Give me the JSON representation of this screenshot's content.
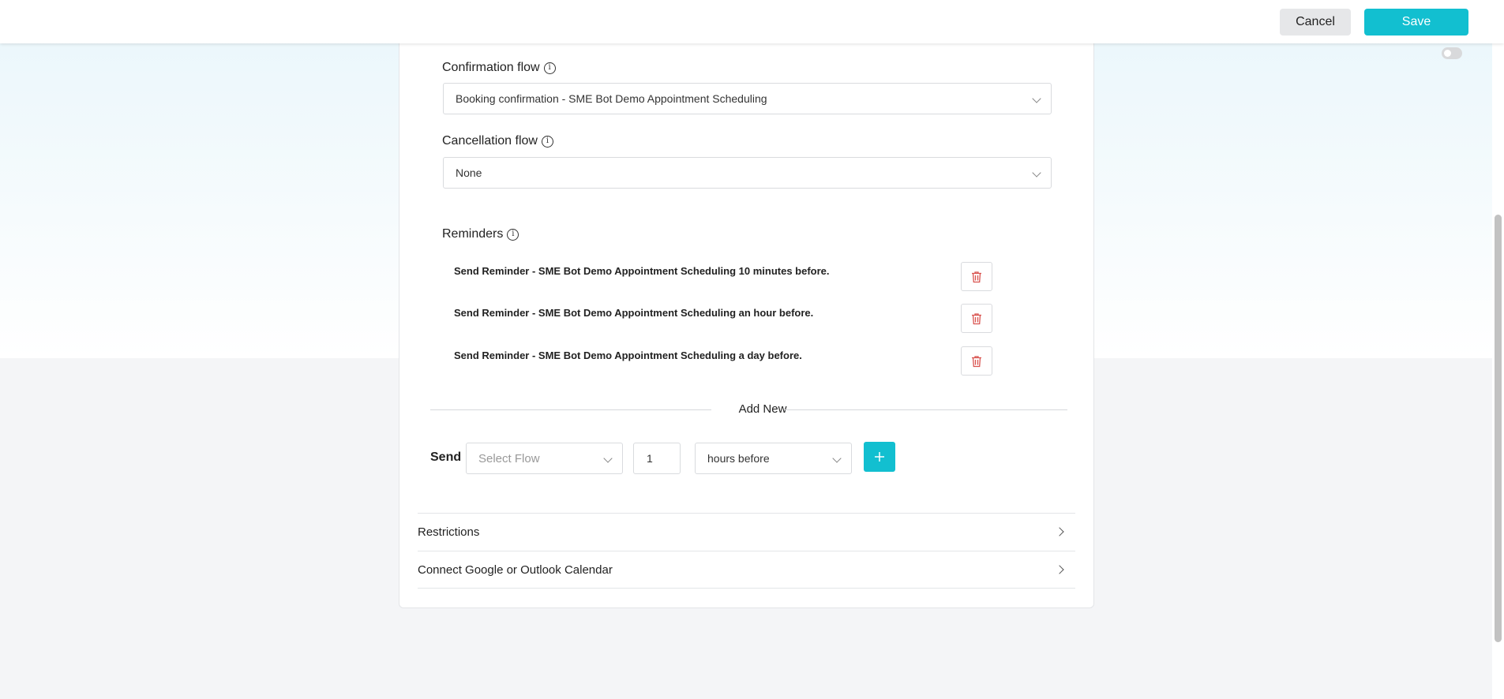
{
  "toolbar": {
    "cancel_label": "Cancel",
    "save_label": "Save"
  },
  "confirmation": {
    "label": "Confirmation flow",
    "value": "Booking confirmation - SME Bot Demo Appointment Scheduling"
  },
  "cancellation": {
    "label": "Cancellation flow",
    "value": "None"
  },
  "reminders": {
    "label": "Reminders",
    "items": [
      {
        "text": "Send Reminder - SME Bot Demo Appointment Scheduling 10 minutes before."
      },
      {
        "text": "Send Reminder - SME Bot Demo Appointment Scheduling an hour before."
      },
      {
        "text": "Send Reminder - SME Bot Demo Appointment Scheduling a day before."
      }
    ]
  },
  "add_new": {
    "label": "Add New",
    "send_label": "Send",
    "flow_placeholder": "Select Flow",
    "amount": "1",
    "unit": "hours before"
  },
  "sections": [
    {
      "label": "Restrictions"
    },
    {
      "label": "Connect Google or Outlook Calendar"
    }
  ],
  "colors": {
    "accent": "#12bfd0",
    "delete": "#d9534f"
  },
  "icons": {
    "info": "info-icon",
    "delete": "trash-icon",
    "add": "plus-icon",
    "expand": "chevron-right-icon",
    "dropdown": "chevron-down-icon"
  }
}
